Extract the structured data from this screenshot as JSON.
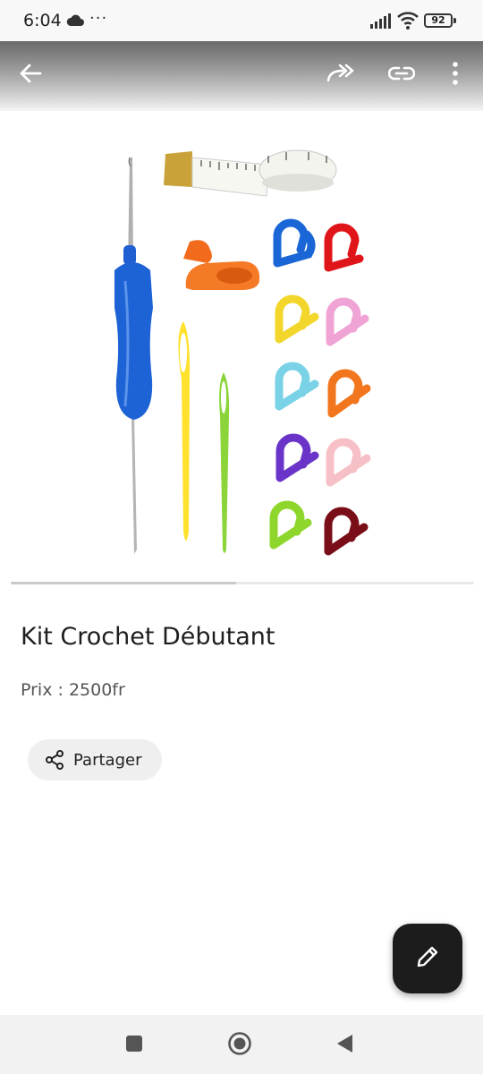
{
  "status_bar": {
    "time": "6:04",
    "overflow_dots": "···",
    "battery": "92"
  },
  "app_bar": {
    "icons": [
      "back-arrow-icon",
      "forward-share-icon",
      "link-icon",
      "more-vertical-icon"
    ]
  },
  "product": {
    "image_icon": "crochet-kit-image",
    "title": "Kit Crochet Débutant",
    "price": "Prix : 2500fr",
    "carousel_position": 0.5
  },
  "share_button": {
    "label": "Partager",
    "icon": "share-icon"
  },
  "fab": {
    "icon": "pencil-edit-icon"
  },
  "nav_bar": {
    "icons": [
      "recent-apps-square-icon",
      "home-circle-icon",
      "back-triangle-icon"
    ]
  },
  "colors": {
    "fab_background": "#1c1c1c",
    "share_button_background": "#efefef",
    "title_text": "#1e1e1e",
    "price_text": "#555555"
  }
}
